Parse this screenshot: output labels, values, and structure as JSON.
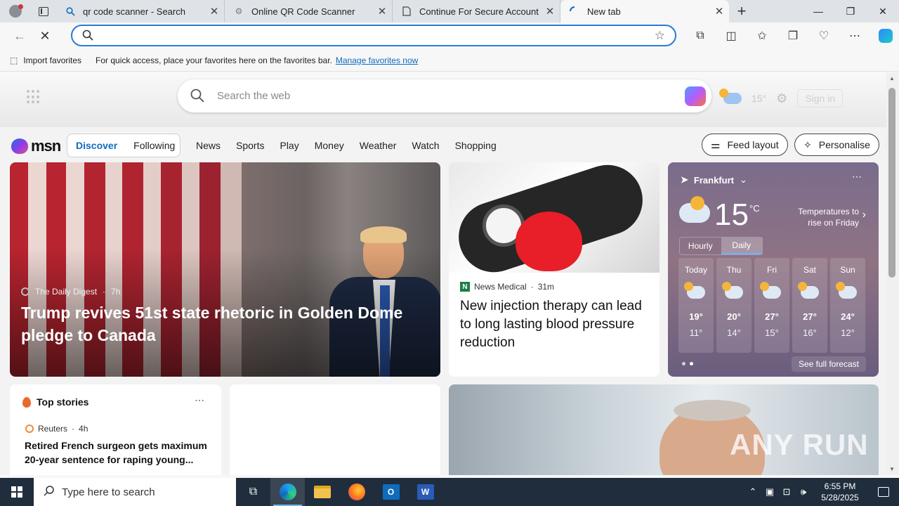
{
  "browser": {
    "tabs": [
      {
        "title": "qr code scanner - Search",
        "icon": "search-favicon"
      },
      {
        "title": "Online QR Code Scanner",
        "icon": "gear-favicon"
      },
      {
        "title": "Continue For Secure Account Lo",
        "icon": "page-favicon"
      },
      {
        "title": "New tab",
        "icon": "loading-favicon"
      }
    ],
    "window_controls": {
      "minimize": "—",
      "restore": "❐",
      "close": "✕"
    },
    "address_value": "",
    "favbar": {
      "import_label": "Import favorites",
      "hint": "For quick access, place your favorites here on the favorites bar.",
      "manage_link": "Manage favorites now"
    }
  },
  "msn": {
    "search_placeholder": "Search the web",
    "header_temp": "15°",
    "sign_in": "Sign in",
    "logo_text": "msn",
    "feed_tabs": [
      "Discover",
      "Following"
    ],
    "nav_links": [
      "News",
      "Sports",
      "Play",
      "Money",
      "Weather",
      "Watch",
      "Shopping"
    ],
    "feed_layout": "Feed layout",
    "personalise": "Personalise"
  },
  "hero_story": {
    "source": "The Daily Digest",
    "age": "7h",
    "headline": "Trump revives 51st state rhetoric in Golden Dome pledge to Canada"
  },
  "medical_story": {
    "source": "News Medical",
    "age": "31m",
    "headline": "New injection therapy can lead to long lasting blood pressure reduction"
  },
  "weather": {
    "city": "Frankfurt",
    "temp": "15",
    "unit": "°C",
    "note": "Temperatures to rise on Friday",
    "modes": [
      "Hourly",
      "Daily"
    ],
    "forecast": [
      {
        "day": "Today",
        "hi": "19°",
        "lo": "11°"
      },
      {
        "day": "Thu",
        "hi": "20°",
        "lo": "14°"
      },
      {
        "day": "Fri",
        "hi": "27°",
        "lo": "15°"
      },
      {
        "day": "Sat",
        "hi": "27°",
        "lo": "16°"
      },
      {
        "day": "Sun",
        "hi": "24°",
        "lo": "12°"
      }
    ],
    "full_forecast": "See full forecast"
  },
  "top_stories": {
    "title": "Top stories",
    "source": "Reuters",
    "age": "4h",
    "headline": "Retired French surgeon gets maximum 20-year sentence for raping young..."
  },
  "watermark": "ANY RUN",
  "taskbar": {
    "search_placeholder": "Type here to search",
    "time": "6:55 PM",
    "date": "5/28/2025"
  }
}
